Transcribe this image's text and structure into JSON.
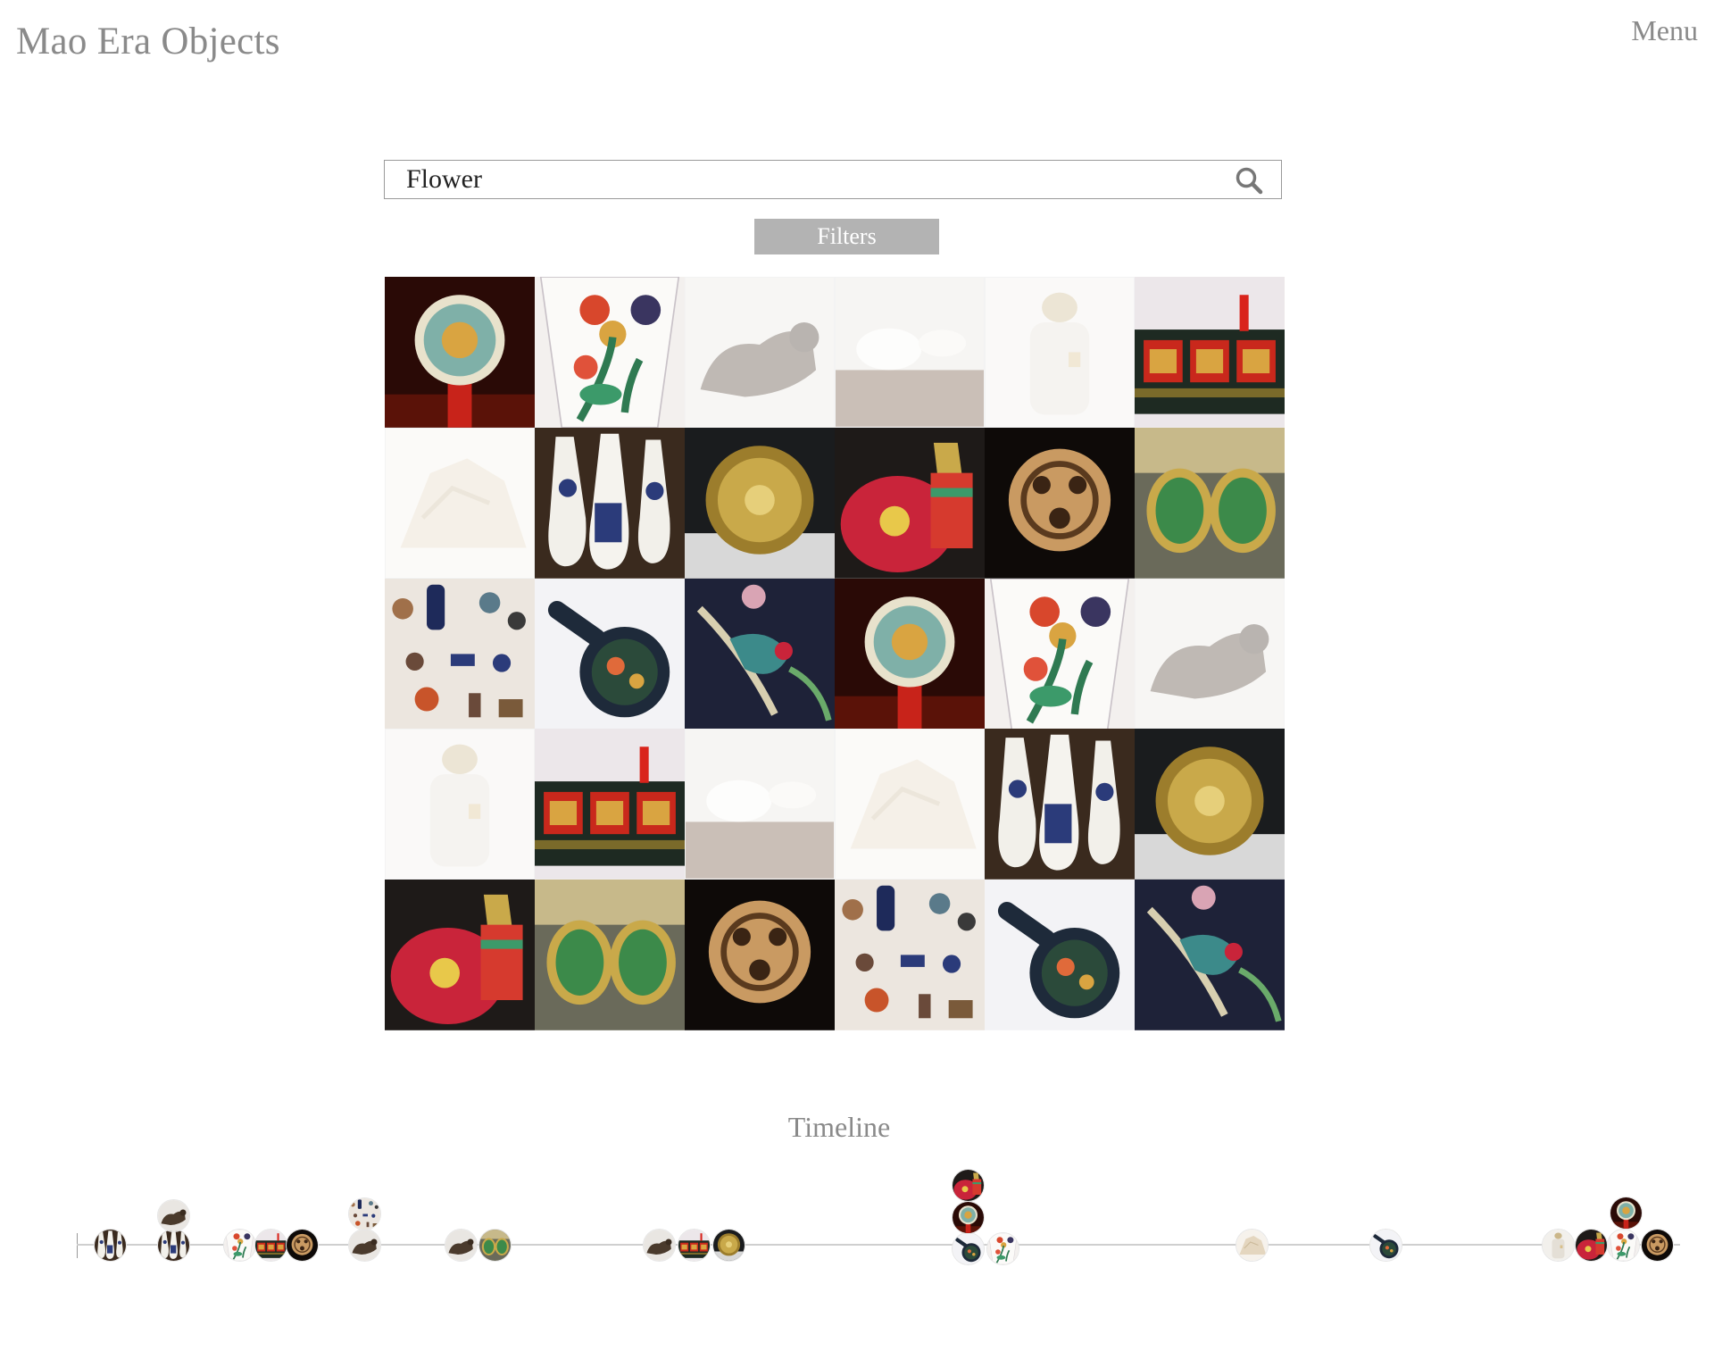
{
  "header": {
    "site_title": "Mao Era Objects",
    "menu_label": "Menu"
  },
  "search": {
    "value": "Flower",
    "placeholder": ""
  },
  "filters_label": "Filters",
  "timeline": {
    "heading": "Timeline"
  },
  "grid_tiles": [
    {
      "subject": "dragon-plate",
      "state": "active"
    },
    {
      "subject": "flower-vase",
      "state": "active"
    },
    {
      "subject": "bronze-animal",
      "state": "faded"
    },
    {
      "subject": "porcelain-cup",
      "state": "faded"
    },
    {
      "subject": "lidded-jar",
      "state": "faded"
    },
    {
      "subject": "painted-cabinet",
      "state": "active"
    },
    {
      "subject": "carved-stone",
      "state": "faded"
    },
    {
      "subject": "blue-white-spoons",
      "state": "active"
    },
    {
      "subject": "gold-flower-disc",
      "state": "active"
    },
    {
      "subject": "red-enamel-vase",
      "state": "active"
    },
    {
      "subject": "carved-jade-pendant",
      "state": "active"
    },
    {
      "subject": "jade-earrings",
      "state": "active"
    },
    {
      "subject": "miniature-objects",
      "state": "active"
    },
    {
      "subject": "cloisonne-pan",
      "state": "active"
    },
    {
      "subject": "bird-embroidery",
      "state": "active"
    },
    {
      "subject": "dragon-plate",
      "state": "active"
    },
    {
      "subject": "flower-vase",
      "state": "active"
    },
    {
      "subject": "bronze-animal",
      "state": "faded"
    },
    {
      "subject": "lidded-jar",
      "state": "faded"
    },
    {
      "subject": "painted-cabinet",
      "state": "active"
    },
    {
      "subject": "porcelain-cup",
      "state": "faded"
    },
    {
      "subject": "carved-stone",
      "state": "faded"
    },
    {
      "subject": "blue-white-spoons",
      "state": "active"
    },
    {
      "subject": "gold-flower-disc",
      "state": "active"
    },
    {
      "subject": "red-enamel-vase",
      "state": "active"
    },
    {
      "subject": "jade-earrings",
      "state": "active"
    },
    {
      "subject": "carved-jade-pendant",
      "state": "active"
    },
    {
      "subject": "miniature-objects",
      "state": "active"
    },
    {
      "subject": "cloisonne-pan",
      "state": "active"
    },
    {
      "subject": "bird-embroidery",
      "state": "active"
    }
  ],
  "timeline_items": [
    {
      "subject": "blue-white-spoons"
    },
    {
      "subject": "blue-white-spoons"
    },
    {
      "subject": "bronze-animal"
    },
    {
      "subject": "flower-vase"
    },
    {
      "subject": "painted-cabinet"
    },
    {
      "subject": "carved-jade-pendant"
    },
    {
      "subject": "bronze-animal"
    },
    {
      "subject": "miniature-objects"
    },
    {
      "subject": "bronze-animal"
    },
    {
      "subject": "jade-earrings"
    },
    {
      "subject": "bronze-animal"
    },
    {
      "subject": "painted-cabinet"
    },
    {
      "subject": "gold-flower-disc"
    },
    {
      "subject": "cloisonne-pan"
    },
    {
      "subject": "red-enamel-vase"
    },
    {
      "subject": "dragon-plate"
    },
    {
      "subject": "flower-vase"
    },
    {
      "subject": "carved-stone"
    },
    {
      "subject": "cloisonne-pan"
    },
    {
      "subject": "lidded-jar"
    },
    {
      "subject": "red-enamel-vase"
    },
    {
      "subject": "flower-vase"
    },
    {
      "subject": "dragon-plate"
    },
    {
      "subject": "carved-jade-pendant"
    }
  ],
  "colors": {
    "title_gray": "#8a8a8a",
    "filters_bg": "#b3b3b3",
    "axis": "#cfcfcf"
  }
}
